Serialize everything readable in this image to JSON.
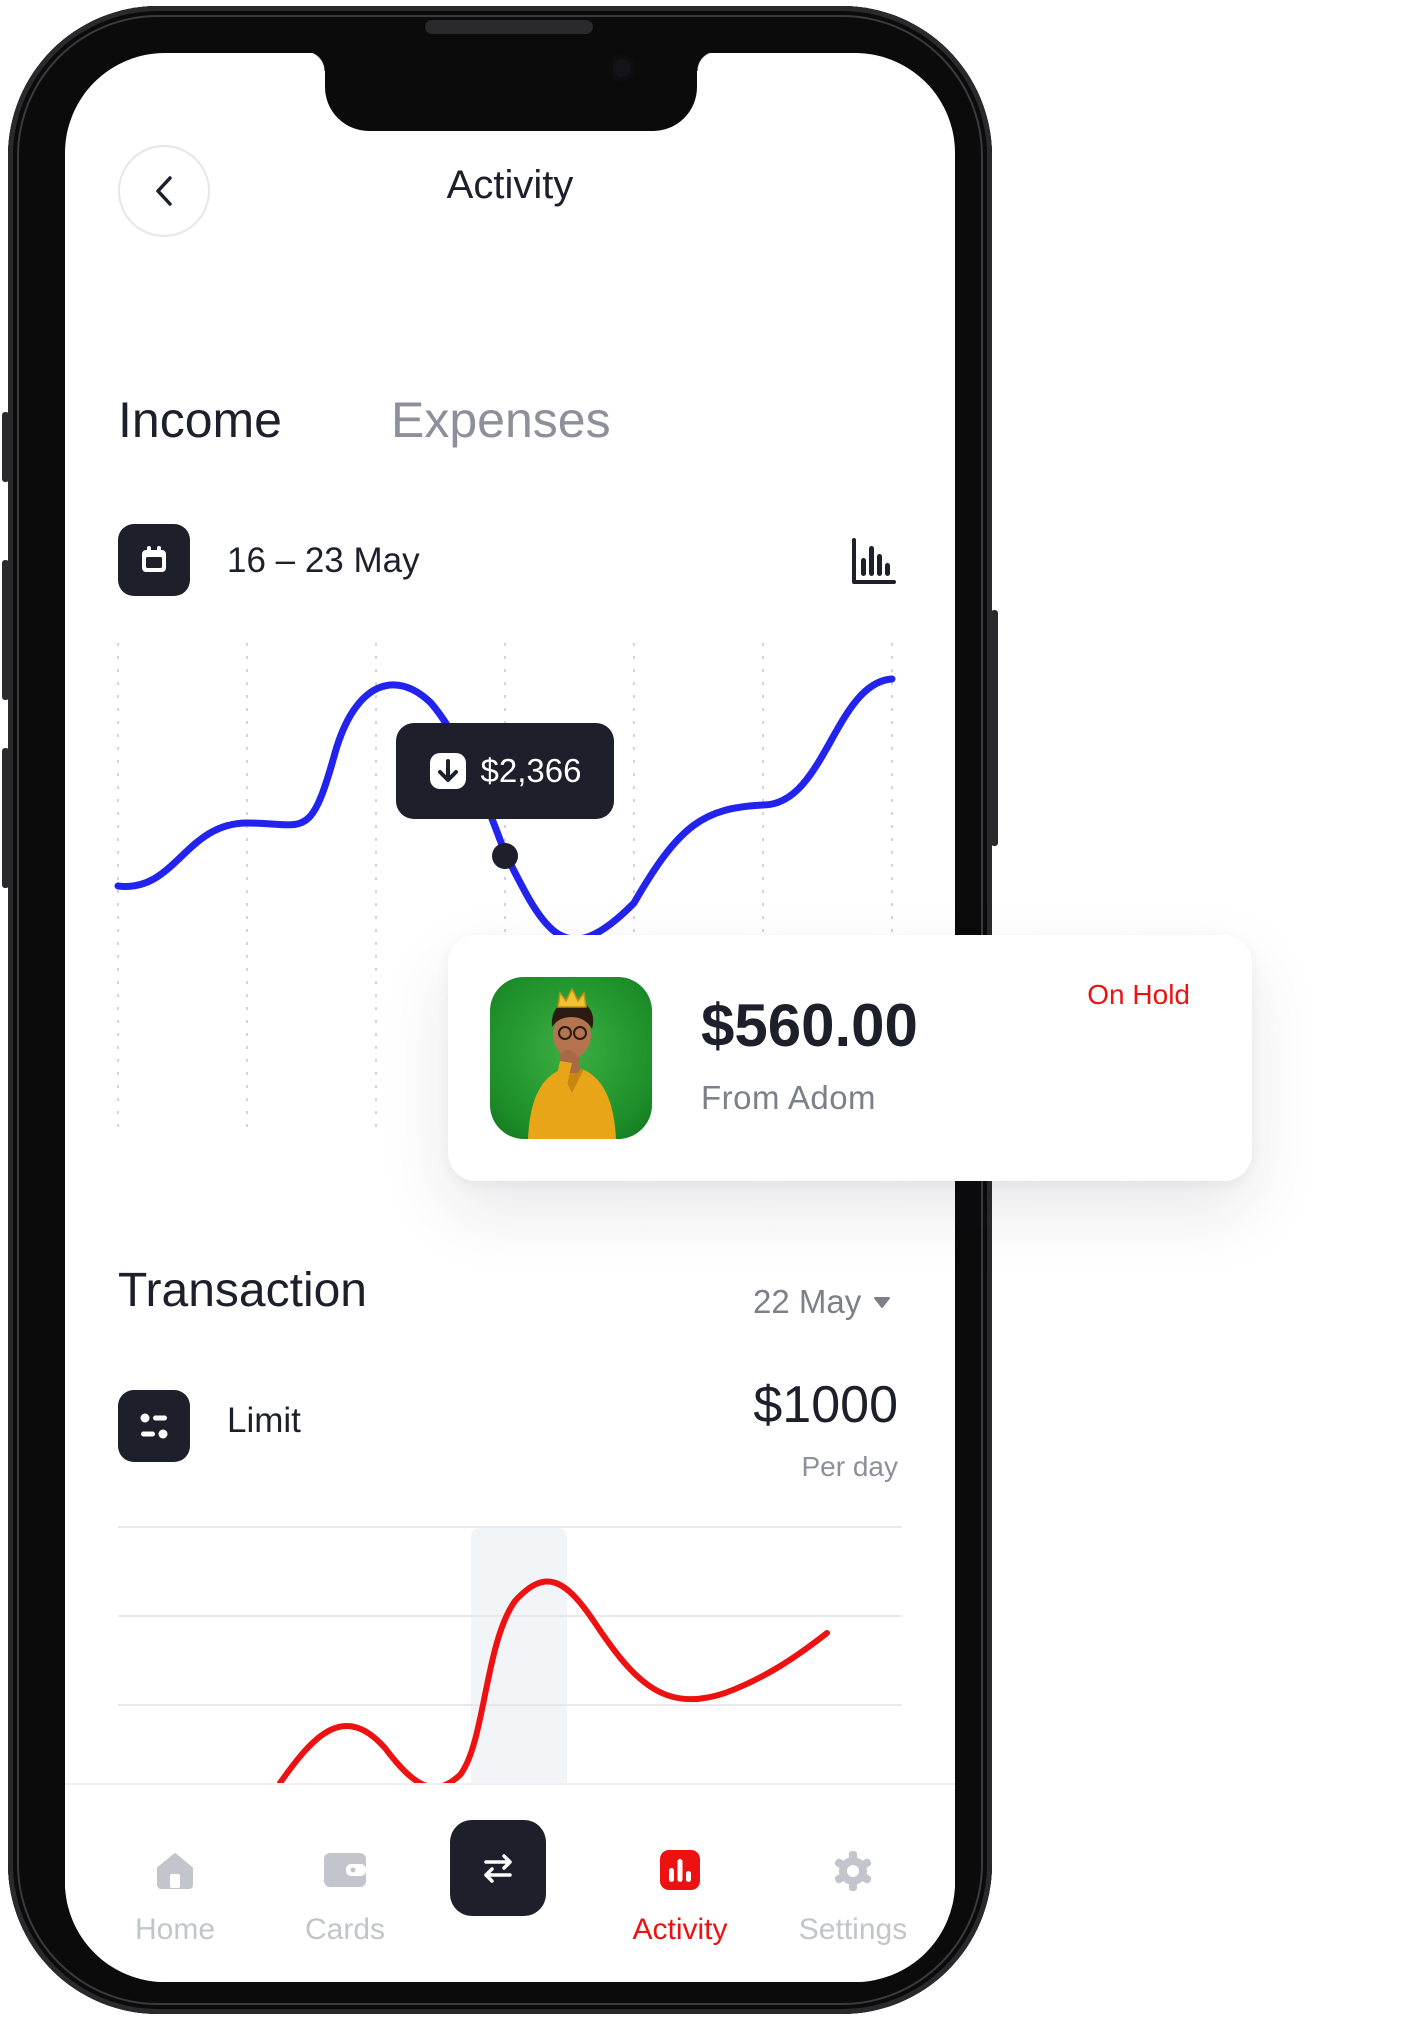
{
  "header": {
    "title": "Activity"
  },
  "tabs": [
    {
      "label": "Income",
      "active": true
    },
    {
      "label": "Expenses",
      "active": false
    }
  ],
  "income": {
    "date_range": "16 – 23 May",
    "tooltip_value": "$2,366"
  },
  "notification": {
    "amount": "$560.00",
    "from": "From Adom",
    "status": "On Hold"
  },
  "transaction": {
    "title": "Transaction",
    "date_filter": "22 May",
    "limit_label": "Limit",
    "limit_amount": "$1000",
    "limit_period": "Per day"
  },
  "nav": {
    "items": [
      {
        "label": "Home",
        "icon": "home-icon",
        "active": false
      },
      {
        "label": "Cards",
        "icon": "wallet-icon",
        "active": false
      },
      {
        "label": "Activity",
        "icon": "activity-chart-icon",
        "active": true
      },
      {
        "label": "Settings",
        "icon": "gear-icon",
        "active": false
      }
    ],
    "center_icon": "transfer-arrows-icon"
  },
  "colors": {
    "primary_dark": "#1d1f2b",
    "income_line": "#2323ee",
    "transaction_line": "#ee1111",
    "active_nav": "#ee1111",
    "inactive_nav": "#c3c5cc",
    "avatar_background": "#1e8f2a"
  }
}
